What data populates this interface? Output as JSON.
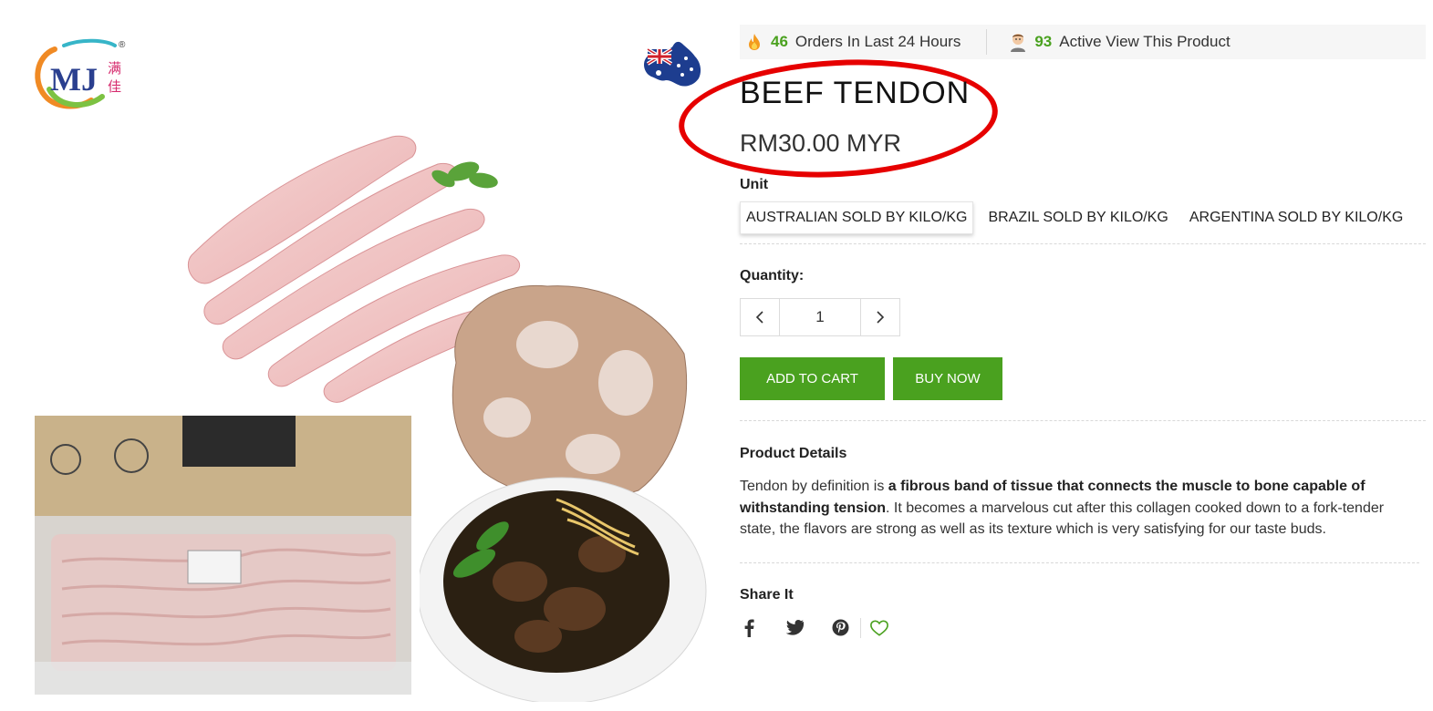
{
  "stats": {
    "orders_count": "46",
    "orders_text": "Orders In Last 24 Hours",
    "viewers_count": "93",
    "viewers_text": "Active View This Product"
  },
  "product": {
    "title": "BEEF TENDON",
    "price": "RM30.00 MYR"
  },
  "unit": {
    "label": "Unit",
    "options": [
      "AUSTRALIAN SOLD BY KILO/KG",
      "BRAZIL SOLD BY KILO/KG",
      "ARGENTINA SOLD BY KILO/KG"
    ],
    "selected_index": 0
  },
  "quantity": {
    "label": "Quantity:",
    "value": "1"
  },
  "buttons": {
    "add_to_cart": "ADD TO CART",
    "buy_now": "BUY NOW"
  },
  "details": {
    "label": "Product Details",
    "desc_start": "Tendon by definition is ",
    "desc_bold": "a fibrous band of tissue that connects the muscle to bone capable of withstanding tension",
    "desc_end": ". It becomes a marvelous cut after this collagen cooked down to a fork-tender state, the flavors are strong as well as its texture which is very satisfying for our taste buds."
  },
  "share": {
    "label": "Share It",
    "icons": [
      "facebook-icon",
      "twitter-icon",
      "pinterest-icon",
      "heart-icon"
    ]
  },
  "logo": {
    "text": "MJ",
    "chinese": "满佳",
    "registered": "®"
  },
  "colors": {
    "accent_green": "#4aa11f",
    "highlight_red": "#e60000"
  }
}
